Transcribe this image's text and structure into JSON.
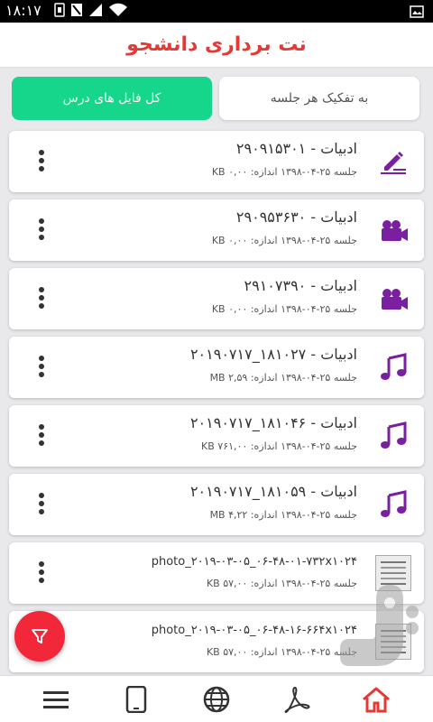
{
  "status_bar": {
    "time": "۱۸:۱۷"
  },
  "app": {
    "title": "نت برداری دانشجو",
    "accent": "#e53935"
  },
  "tabs": [
    {
      "label": "کل فایل های درس",
      "active": true,
      "color": "#16d68b"
    },
    {
      "label": "به تفکیک هر جلسه",
      "active": false
    }
  ],
  "files": [
    {
      "icon": "pencil-note-icon",
      "name": "ادبیات - ۲۹۰۹۱۵۳۰۱",
      "meta": "جلسه ۲۵-۰۴-۱۳۹۸ اندازه: ۰,۰۰ KB"
    },
    {
      "icon": "video-camera-icon",
      "name": "ادبیات - ۲۹۰۹۵۳۶۳۰",
      "meta": "جلسه ۲۵-۰۴-۱۳۹۸ اندازه: ۰,۰۰ KB"
    },
    {
      "icon": "video-camera-icon",
      "name": "ادبیات - ۲۹۱۰۷۳۹۰",
      "meta": "جلسه ۲۵-۰۴-۱۳۹۸ اندازه: ۰,۰۰ KB"
    },
    {
      "icon": "music-note-icon",
      "name": "ادبیات - ۱۸۱۰۲۷_۲۰۱۹۰۷۱۷",
      "meta": "جلسه ۲۵-۰۴-۱۳۹۸ اندازه: ۲,۵۹ MB"
    },
    {
      "icon": "music-note-icon",
      "name": "ادبیات - ۱۸۱۰۴۶_۲۰۱۹۰۷۱۷",
      "meta": "جلسه ۲۵-۰۴-۱۳۹۸ اندازه: ۷۶۱,۰۰ KB"
    },
    {
      "icon": "music-note-icon",
      "name": "ادبیات - ۱۸۱۰۵۹_۲۰۱۹۰۷۱۷",
      "meta": "جلسه ۲۵-۰۴-۱۳۹۸ اندازه: ۴,۲۲ MB"
    },
    {
      "icon": "photo-thumbnail",
      "name": "photo_۲۰۱۹-۰۳-۰۵_۰۶-۴۸-۰۱-۷۳۲x۱۰۲۴",
      "meta": "جلسه ۲۵-۰۴-۱۳۹۸ اندازه: ۵۷,۰۰ KB"
    },
    {
      "icon": "photo-thumbnail",
      "name": "photo_۲۰۱۹-۰۳-۰۵_۰۶-۴۸-۱۶-۶۶۴x۱۰۲۴",
      "meta": "جلسه ۲۵-۰۴-۱۳۹۸ اندازه: ۵۷,۰۰ KB"
    }
  ],
  "colors": {
    "icon_purple": "#7b1fa2",
    "fab_red": "#f2283a",
    "home_red": "#e53935"
  },
  "bottom_nav": [
    "menu-icon",
    "tablet-icon",
    "globe-icon",
    "pdf-icon",
    "home-icon"
  ]
}
